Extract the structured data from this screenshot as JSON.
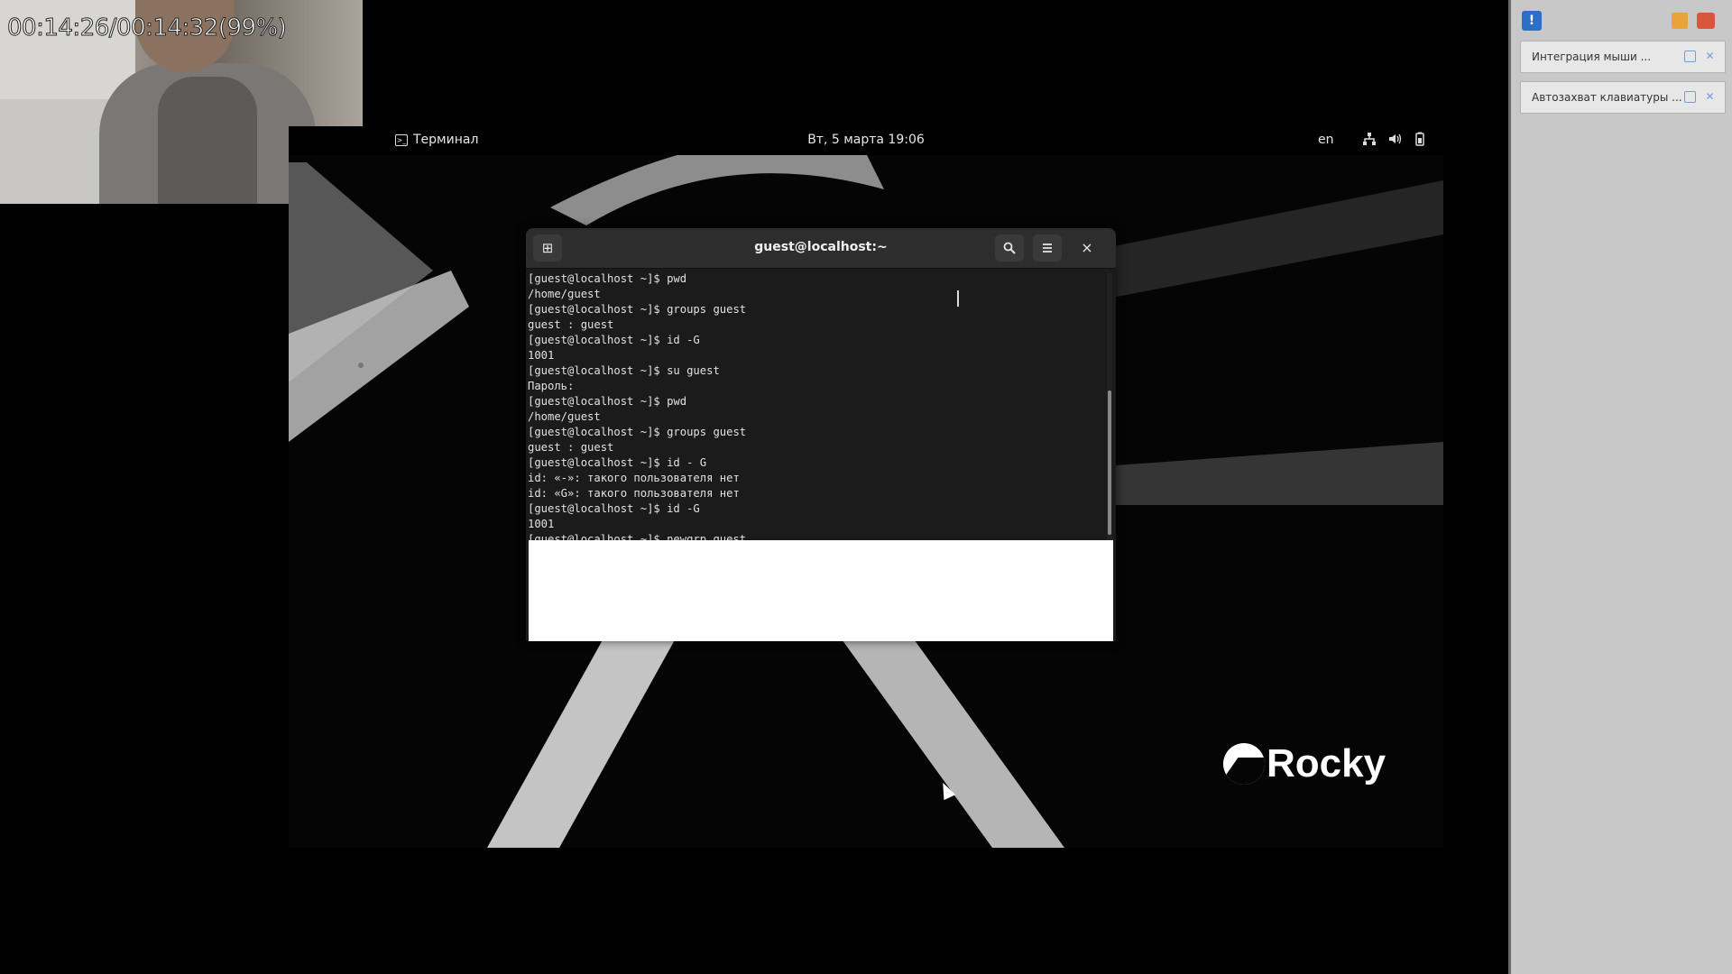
{
  "recording": {
    "timer": "00:14:26/00:14:32(99%)"
  },
  "topbar": {
    "app_name": "Терминал",
    "clock": "Вт, 5 марта  19:06",
    "lang": "en",
    "tray_icons": [
      "network-icon",
      "volume-icon",
      "battery-icon"
    ]
  },
  "terminal": {
    "title": "guest@localhost:~",
    "new_tab_icon": "new-tab-icon",
    "search_icon": "search-icon",
    "menu_icon": "hamburger-menu-icon",
    "close_icon": "×",
    "lines": [
      "[guest@localhost ~]$ pwd",
      "/home/guest",
      "[guest@localhost ~]$ groups guest",
      "guest : guest",
      "[guest@localhost ~]$ id -G",
      "1001",
      "[guest@localhost ~]$ su guest",
      "Пароль:",
      "[guest@localhost ~]$ pwd",
      "/home/guest",
      "[guest@localhost ~]$ groups guest",
      "guest : guest",
      "[guest@localhost ~]$ id - G",
      "id: «-»: такого пользователя нет",
      "id: «G»: такого пользователя нет",
      "[guest@localhost ~]$ id -G",
      "1001",
      "[guest@localhost ~]$ newgrp guest"
    ]
  },
  "wallpaper": {
    "brand": "Rocky"
  },
  "side_panel": {
    "notifications": [
      {
        "text": "Интеграция мыши ..."
      },
      {
        "text": "Автозахват клавиатуры ..."
      }
    ]
  },
  "colors": {
    "desktop_bg": "#050505",
    "terminal_bg": "#1b1b1b",
    "headerbar_bg": "#2d2d2d",
    "panel_bg": "#c8c8c8"
  }
}
